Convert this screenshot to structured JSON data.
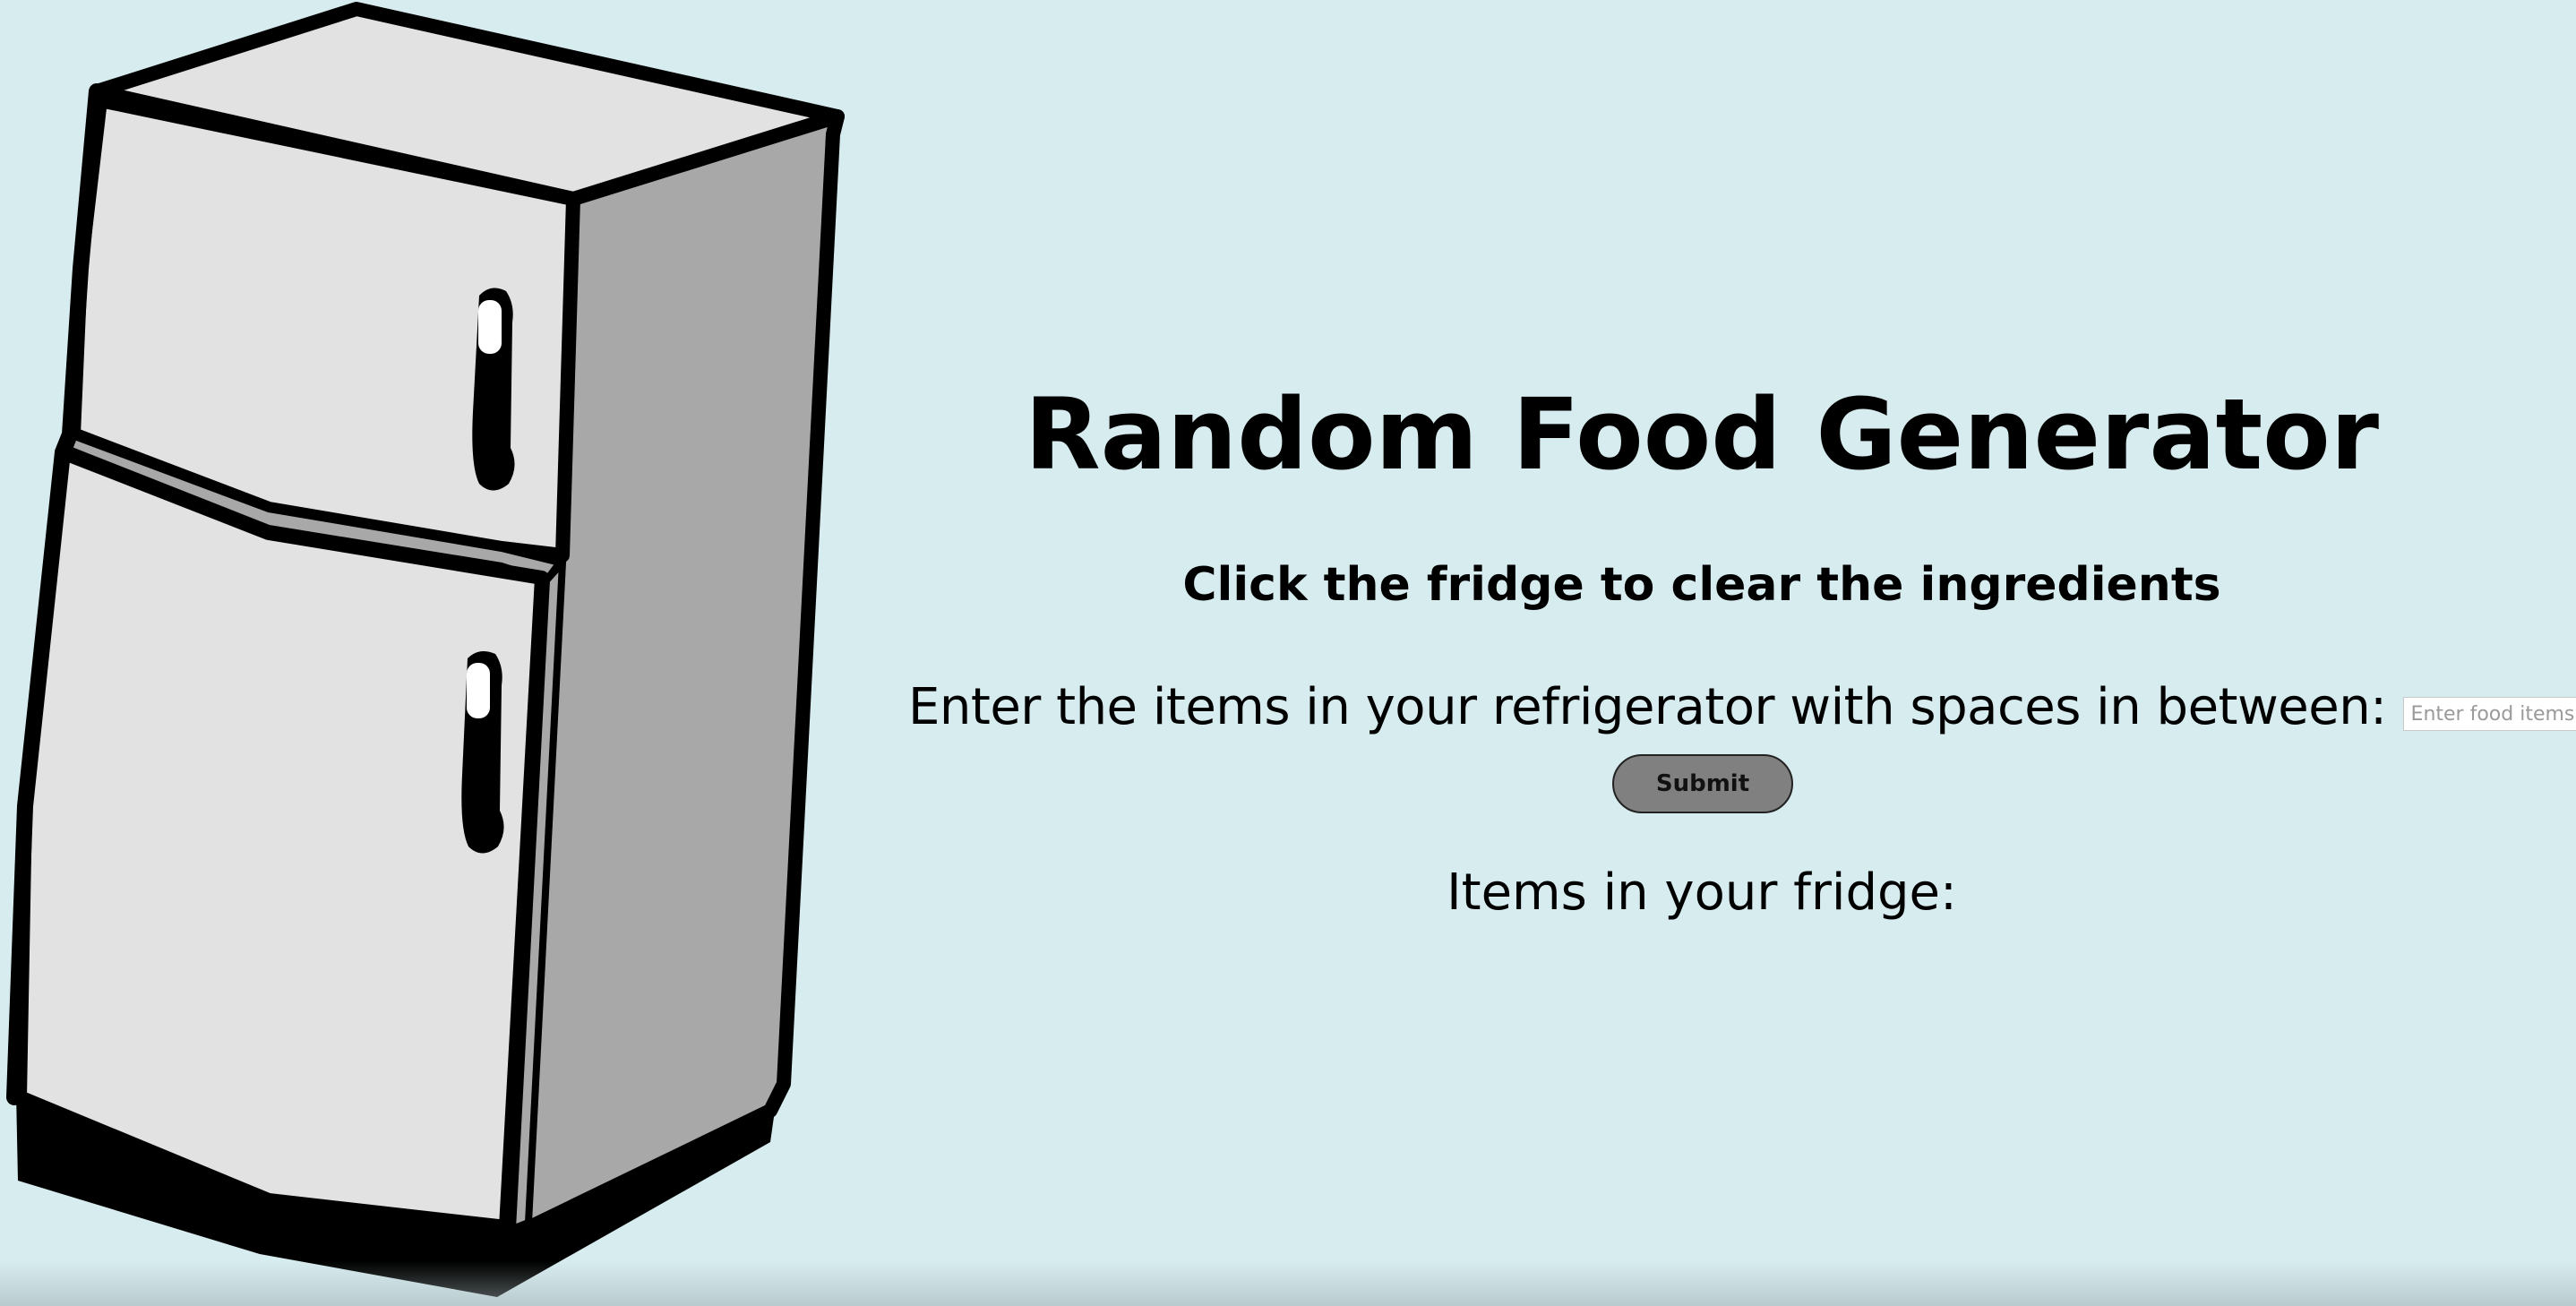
{
  "page": {
    "title": "Random Food Generator",
    "subtitle": "Click the fridge to clear the ingredients",
    "background_color": "#d7ecef"
  },
  "fridge": {
    "icon": "refrigerator-icon",
    "action": "clear-ingredients"
  },
  "entry": {
    "label": "Enter the items in your refrigerator with spaces in between:",
    "placeholder": "Enter food items",
    "value": ""
  },
  "submit": {
    "label": "Submit",
    "color": "#808080"
  },
  "fridge_items": {
    "heading": "Items in your fridge:",
    "items": []
  }
}
